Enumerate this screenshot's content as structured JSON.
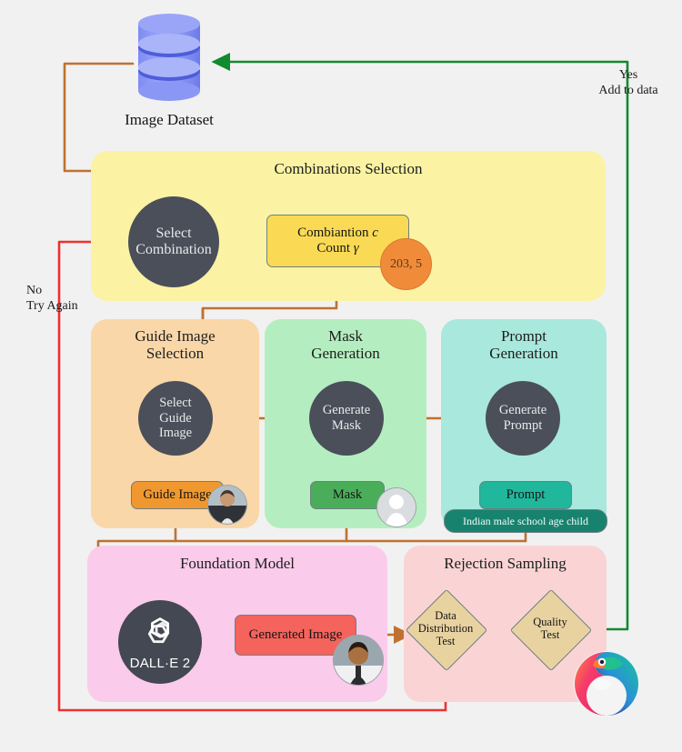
{
  "diagram": {
    "background_color": "#f1f1f1",
    "dataset": {
      "caption": "Image Dataset",
      "icon": "database-cylinder-icon",
      "color": "#8a93f0"
    },
    "edge_labels": {
      "no": "No",
      "try_again": "Try Again",
      "yes": "Yes",
      "add_to_data": "Add to data"
    },
    "panels": {
      "combinations": {
        "title": "Combinations Selection",
        "color": "#fbf3a3",
        "process": "Select Combination",
        "box_line1": "Combiantion",
        "box_line1_italic": "c",
        "box_line2": "Count",
        "box_line2_italic": "γ",
        "badge": "203, 5",
        "badge_color": "#f08b3a",
        "box_color": "#fada54"
      },
      "guide": {
        "title_line1": "Guide Image",
        "title_line2": "Selection",
        "color": "#fad7a8",
        "process_line1": "Select",
        "process_line2": "Guide",
        "process_line3": "Image",
        "box_label": "Guide Image",
        "box_color": "#f0982f",
        "thumbnail": "guide-image-photo-thumbnail"
      },
      "mask": {
        "title_line1": "Mask",
        "title_line2": "Generation",
        "color": "#b4eec0",
        "process_line1": "Generate",
        "process_line2": "Mask",
        "box_label": "Mask",
        "box_color": "#4aad5a",
        "thumbnail": "mask-silhouette-thumbnail"
      },
      "prompt": {
        "title_line1": "Prompt",
        "title_line2": "Generation",
        "color": "#a9e8dd",
        "process_line1": "Generate",
        "process_line2": "Prompt",
        "box_label": "Prompt",
        "box_color": "#20b79c",
        "prompt_text": "Indian male school age child"
      },
      "foundation": {
        "title": "Foundation Model",
        "color": "#fbcbeb",
        "model_label": "DALL·E 2",
        "model_icon": "openai-logo-icon",
        "box_label": "Generated Image",
        "box_color": "#f4635c",
        "thumbnail": "generated-image-photo-thumbnail"
      },
      "rejection": {
        "title": "Rejection Sampling",
        "color": "#fad4d4",
        "test1_line1": "Data",
        "test1_line2": "Distribution",
        "test1_line3": "Test",
        "test2_line1": "Quality",
        "test2_line2": "Test",
        "diamond_color": "#e8d2a0",
        "logo": "chameleon-logo-icon"
      }
    },
    "connector_colors": {
      "flow": "#c0712f",
      "reject": "#f03030",
      "accept": "#128a2e"
    }
  }
}
